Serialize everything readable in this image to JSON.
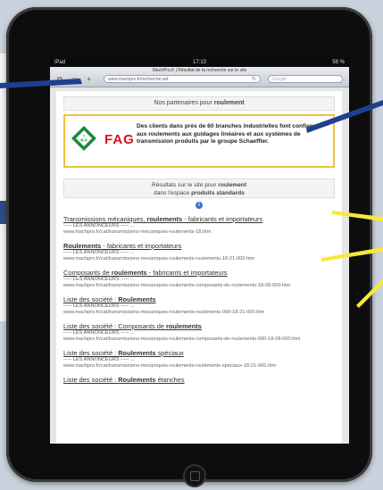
{
  "status_bar": {
    "device": "iPad",
    "time": "17:13",
    "battery": "58 %"
  },
  "browser": {
    "page_title": "MachPro.fr | Résultat de la recherche sur le site",
    "url": "www.machpro.fr/recherche.asf",
    "search_placeholder": "Google"
  },
  "partners": {
    "heading_prefix": "Nos partenaires pour",
    "heading_keyword": "roulement",
    "logo_ina": "INA",
    "logo_fag": "FAG",
    "text": "Des clients dans près de 60 branches industrielles font confiance aux roulements aux guidages linéaires et aux systèmes de transmission produits par le groupe Schaeffler."
  },
  "results_header": {
    "line1_prefix": "Résultats sur le site pour",
    "keyword": "roulement",
    "line2_prefix": "dans l'espace",
    "space": "produits standards"
  },
  "info_icon_label": "i",
  "results": [
    {
      "title_prefix": "Transmissions mécaniques, ",
      "title_bold": "roulements",
      "title_suffix": " - fabricants et importateurs",
      "sub": "----- LES ANNONCEURS ----- ...",
      "url": "www.machpro.fr/cat/transmissions-mecaniques-roulements-18.htm"
    },
    {
      "title_prefix": "",
      "title_bold": "Roulements",
      "title_suffix": " - fabricants et importateurs",
      "sub": "----- LES ANNONCEURS ----- ...",
      "url": "www.machpro.fr/cat/transmissions-mecaniques-roulements-roulements-18-21-000.htm"
    },
    {
      "title_prefix": "Composants de ",
      "title_bold": "roulements",
      "title_suffix": " - fabricants et importateurs",
      "sub": "----- LES ANNONCEURS ----- ...",
      "url": "www.machpro.fr/cat/transmissions-mecaniques-roulements-composants-de-roulements-18-08-000.htm"
    },
    {
      "title_prefix": "Liste des société : ",
      "title_bold": "Roulements",
      "title_suffix": "",
      "sub": "----- LES ANNONCEURS ----- ...",
      "url": "www.machpro.fr/cat/transmissions-mecaniques-roulements-roulements-000-18-21-000.htm"
    },
    {
      "title_prefix": "Liste des société : Composants de ",
      "title_bold": "roulements",
      "title_suffix": "",
      "sub": "----- LES ANNONCEURS ----- ...",
      "url": "www.machpro.fr/cat/transmissions-mecaniques-roulements-composants-de-roulements-000-18-08-000.htm"
    },
    {
      "title_prefix": "Liste des société : ",
      "title_bold": "Roulements",
      "title_suffix": " spéciaux",
      "sub": "----- LES ANNONCEURS ----- ...",
      "url": "www.machpro.fr/cat/transmissions-mecaniques-roulements-roulements-speciaux-18-21-065.htm"
    },
    {
      "title_prefix": "Liste des société : ",
      "title_bold": "Roulements",
      "title_suffix": " étanches",
      "sub": "",
      "url": ""
    }
  ],
  "colors": {
    "fag_red": "#d8141f",
    "ina_green": "#1a8a3c",
    "partner_border": "#f0c13d",
    "callout_yellow": "#f6e93a",
    "callout_blue": "#1f3f8f"
  }
}
